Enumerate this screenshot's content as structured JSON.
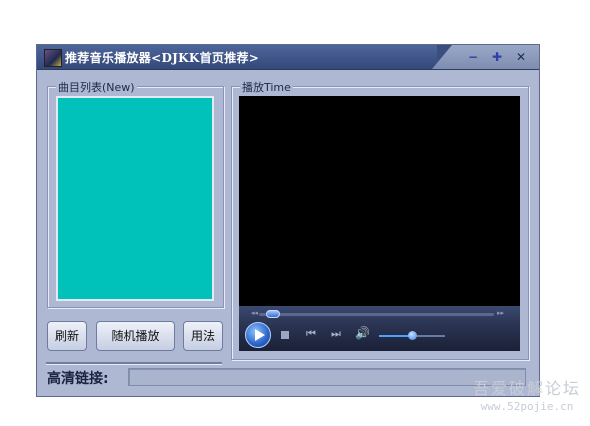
{
  "window": {
    "title": "推荐音乐播放器<DJKK首页推荐>",
    "min_symbol": "−",
    "max_symbol": "✚",
    "close_symbol": "✕"
  },
  "playlist": {
    "group_label": "曲目列表(New)",
    "items": []
  },
  "buttons": {
    "refresh_label": "刷新",
    "random_play_label": "随机播放",
    "usage_label": "用法"
  },
  "player": {
    "group_label": "播放Time",
    "seek_position": 0.03,
    "volume_level": 0.5,
    "icons": [
      "play-icon",
      "stop-icon",
      "previous-icon",
      "next-icon",
      "volume-icon"
    ],
    "rew_symbol": "◂◂",
    "ff_symbol": "▸▸",
    "prev_symbol": "⏮",
    "next_symbol": "⏭",
    "vol_symbol": "🔊"
  },
  "hd_link": {
    "label": "高清链接:",
    "value": ""
  },
  "watermark": {
    "line1": "吾爱破解论坛",
    "line2": "www.52pojie.cn"
  },
  "colors": {
    "window_bg": "#aeb8d2",
    "titlebar": "#3a4f7f",
    "playlist_bg": "#00c2bb",
    "video_bg": "#000000"
  }
}
